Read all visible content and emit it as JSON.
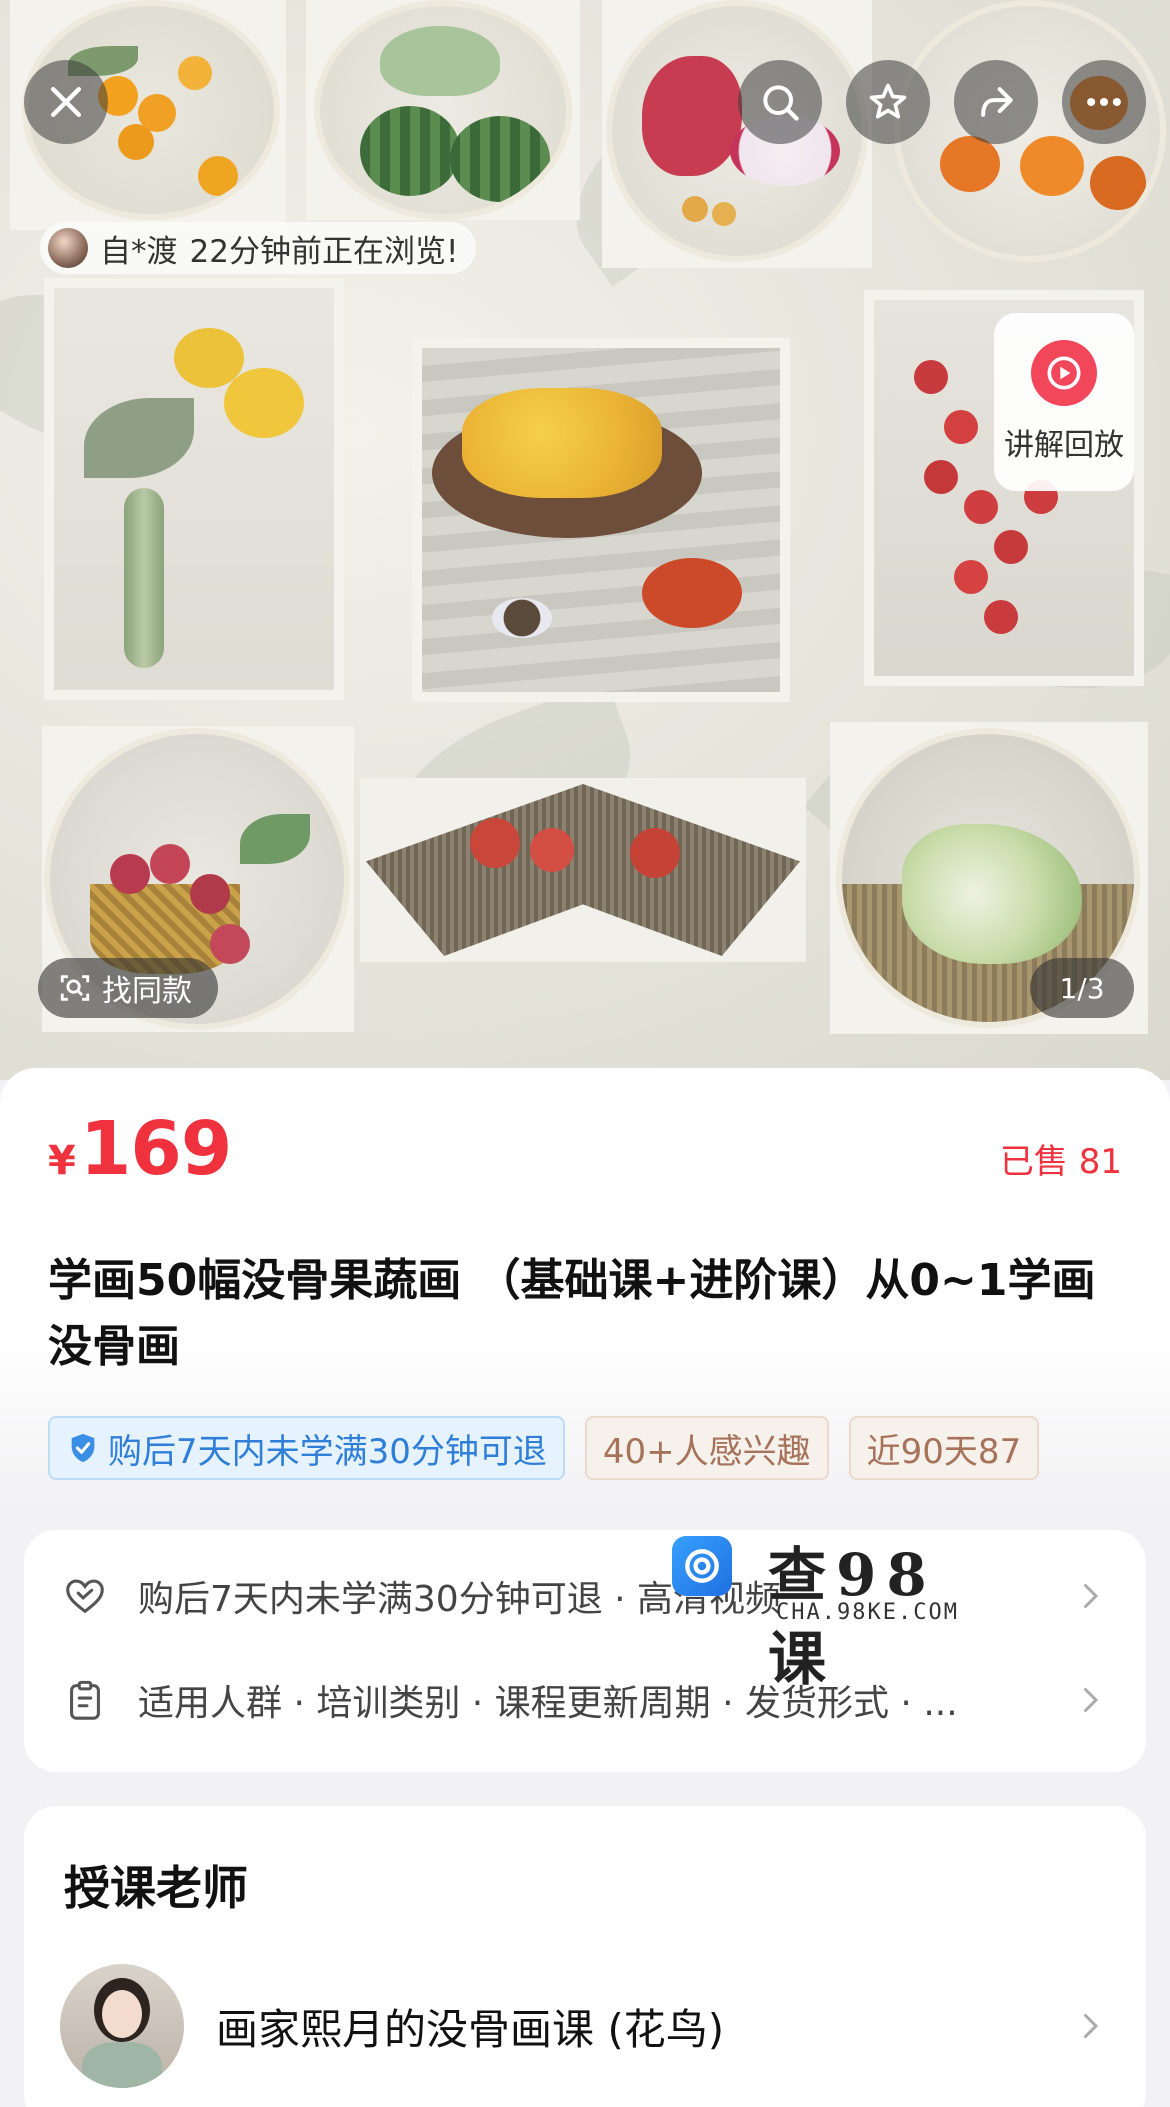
{
  "overlay": {
    "browsing_user": "自*渡",
    "browsing_text": "22分钟前正在浏览!",
    "replay_label": "讲解回放",
    "find_same_label": "找同款",
    "image_counter": "1/3"
  },
  "product": {
    "currency": "¥",
    "price": "169",
    "sold": "已售 81",
    "title": "学画50幅没骨果蔬画 （基础课+进阶课）从0~1学画没骨画",
    "tags": [
      "购后7天内未学满30分钟可退",
      "40+人感兴趣",
      "近90天87"
    ]
  },
  "service": {
    "refund_row": "购后7天内未学满30分钟可退 · 高清视频",
    "specs_row": "适用人群 · 培训类别 · 课程更新周期 · 发货形式 · ..."
  },
  "watermark": {
    "text": "查98课",
    "url": "CHA.98KE.COM"
  },
  "teacher_section": {
    "title": "授课老师",
    "name": "画家熙月的没骨画课 (花鸟)"
  },
  "colors": {
    "price_red": "#f0323f",
    "guarantee_blue": "#2f7fd8",
    "tag_brown": "#a6735a",
    "replay_red": "#f2465b"
  }
}
